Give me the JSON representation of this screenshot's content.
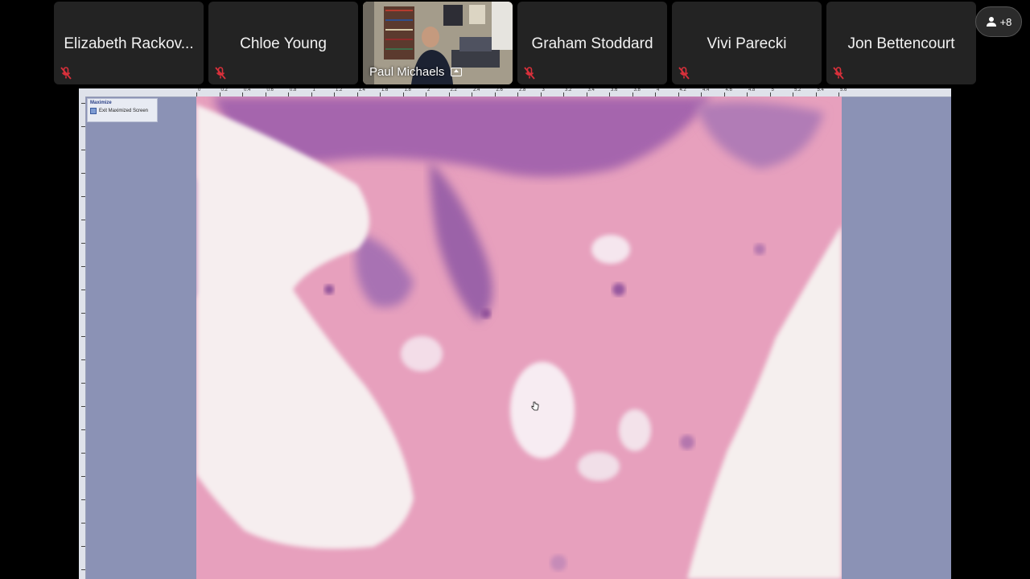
{
  "participants": [
    {
      "name": "Elizabeth Rackov...",
      "muted": true
    },
    {
      "name": "Chloe Young",
      "muted": true
    },
    {
      "name": "Paul Michaels",
      "video": true,
      "sharing": true
    },
    {
      "name": "Graham Stoddard",
      "muted": true
    },
    {
      "name": "Vivi Parecki",
      "muted": true
    },
    {
      "name": "Jon Bettencourt",
      "muted": true
    }
  ],
  "more_participants": {
    "label": "+8",
    "icon": "people-icon"
  },
  "shared_screen": {
    "panel_title": "Maximize",
    "panel_item": "Exit Maximized Screen",
    "ruler_labels": [
      "0",
      "0.2",
      "0.4",
      "0.6",
      "0.8",
      "1",
      "1.2",
      "1.4",
      "1.6",
      "1.8",
      "2",
      "2.2",
      "2.4",
      "2.6",
      "2.8",
      "3",
      "3.2",
      "3.4",
      "3.6",
      "3.8",
      "4",
      "4.2",
      "4.4",
      "4.6",
      "4.8",
      "5",
      "5.2",
      "5.4",
      "5.6"
    ]
  },
  "colors": {
    "tile_bg": "#232323",
    "muted_red": "#d9303b",
    "viewer_bg": "#8b92b5",
    "tissue_pink": "#e7a0bd",
    "tissue_purple": "#9a5fa6"
  }
}
